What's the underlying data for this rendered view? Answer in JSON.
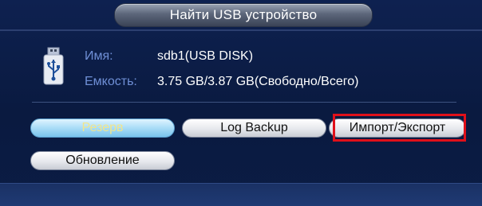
{
  "dialog": {
    "title": "Найти USB устройство"
  },
  "device": {
    "icon": "usb-drive-icon",
    "name_label": "Имя:",
    "name_value": "sdb1(USB DISK)",
    "capacity_label": "Емкость:",
    "capacity_value": "3.75 GB/3.87 GB(Свободно/Всего)"
  },
  "buttons": {
    "backup": "Резерв",
    "log_backup": "Log Backup",
    "import_export": "Импорт/Экспорт",
    "update": "Обновление"
  },
  "colors": {
    "background": "#0b1a3f",
    "label": "#6f8fd6",
    "highlight_box": "#e0101a",
    "active_button": "#a9dcf7",
    "active_button_text": "#f1e58b"
  }
}
